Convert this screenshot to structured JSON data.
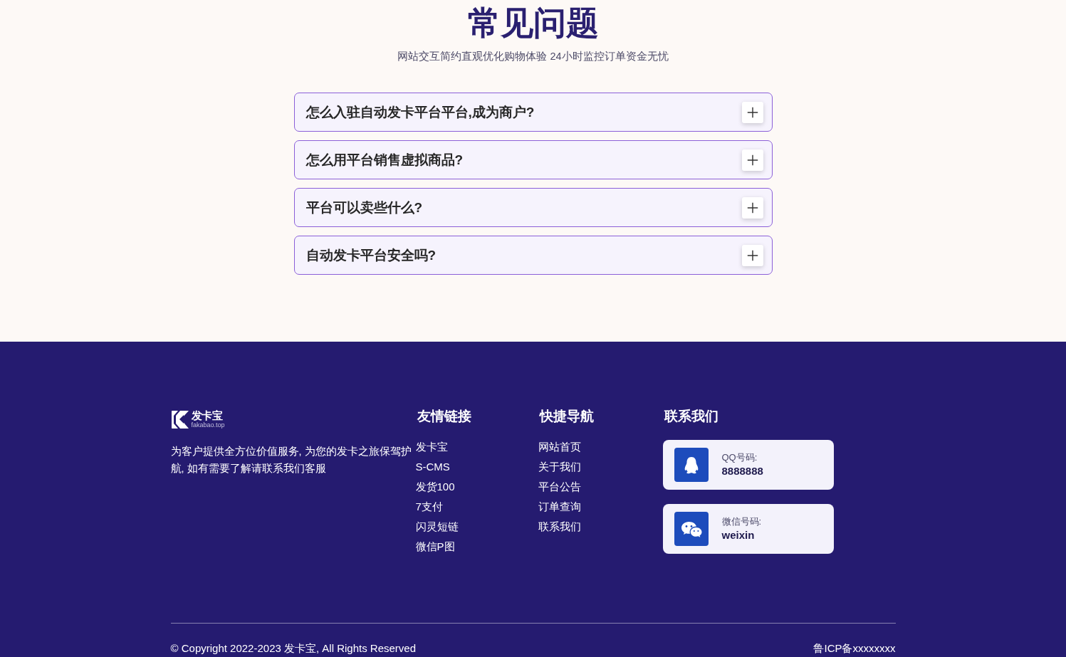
{
  "faq": {
    "title": "常见问题",
    "subtitle": "网站交互简约直观优化购物体验 24小时监控订单资金无忧",
    "items": [
      {
        "question": "怎么入驻自动发卡平台平台,成为商户?",
        "expanded": false
      },
      {
        "question": "怎么用平台销售虚拟商品?",
        "expanded": false
      },
      {
        "question": "平台可以卖些什么?",
        "expanded": false
      },
      {
        "question": "自动发卡平台安全吗?",
        "expanded": false
      }
    ]
  },
  "footer": {
    "logo": {
      "name": "发卡宝",
      "tagline": "fakabao.top"
    },
    "description": "为客户提供全方位价值服务, 为您的发卡之旅保驾护航, 如有需要了解请联系我们客服",
    "columns": [
      {
        "heading": "友情链接",
        "links": [
          "发卡宝",
          "S-CMS",
          "发货100",
          "7支付",
          "闪灵短链",
          "微信P图"
        ]
      },
      {
        "heading": "快捷导航",
        "links": [
          "网站首页",
          "关于我们",
          "平台公告",
          "订单查询",
          "联系我们"
        ]
      }
    ],
    "contact": {
      "heading": "联系我们",
      "cards": [
        {
          "kind": "qq",
          "label": "QQ号码:",
          "value": "8888888"
        },
        {
          "kind": "wechat",
          "label": "微信号码:",
          "value": "weixin"
        }
      ]
    },
    "copyright": "© Copyright 2022-2023 发卡宝, All Rights Reserved",
    "icp": "鲁ICP备xxxxxxxx"
  }
}
